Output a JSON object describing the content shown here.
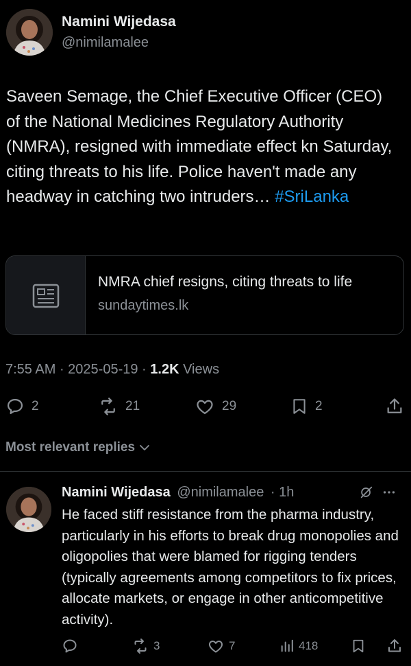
{
  "tweet": {
    "author_name": "Namini Wijedasa",
    "author_handle": "@nimilamalee",
    "text_main": "Saveen Semage, the Chief Executive Officer (CEO) of the National Medicines Regulatory Authority (NMRA), resigned with immediate effect kn Saturday, citing threats to his life. Police haven't made any headway in catching two intruders… ",
    "hashtag": "#SriLanka",
    "link_card": {
      "icon": "article-icon",
      "title": "NMRA chief resigns, citing threats to life",
      "domain": "sundaytimes.lk"
    },
    "time": "7:55 AM",
    "date": "2025-05-19",
    "views_count": "1.2K",
    "views_label": "Views",
    "separator": " · ",
    "actions": {
      "replies": "2",
      "reposts": "21",
      "likes": "29",
      "bookmarks": "2"
    }
  },
  "replies_section": {
    "label": "Most relevant replies"
  },
  "reply": {
    "author_name": "Namini Wijedasa",
    "author_handle": "@nimilamalee",
    "time_ago": "· 1h",
    "text": "He faced stiff resistance from the pharma industry, particularly in his efforts to break drug monopolies and oligopolies that were blamed for rigging tenders (typically agreements among competitors to fix prices, allocate markets, or engage in other anticompetitive activity).",
    "actions": {
      "reposts": "3",
      "likes": "7",
      "views": "418"
    }
  },
  "colors": {
    "background": "#000000",
    "text": "#e7e9ea",
    "secondary": "#8b9096",
    "link": "#1d9bf0",
    "border": "#2f3336"
  }
}
